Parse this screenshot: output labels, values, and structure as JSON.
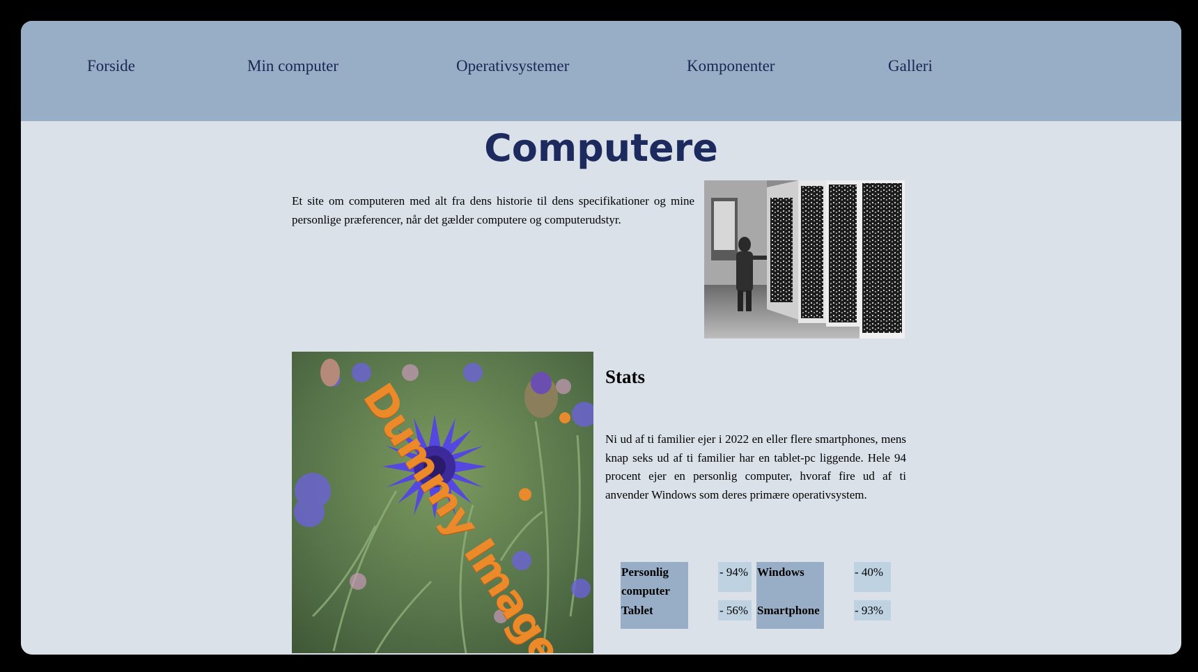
{
  "nav": {
    "items": [
      {
        "label": "Forside"
      },
      {
        "label": "Min computer"
      },
      {
        "label": "Operativsystemer"
      },
      {
        "label": "Komponenter"
      },
      {
        "label": "Galleri"
      }
    ]
  },
  "page": {
    "title": "Computere",
    "intro": "Et site om computeren med alt fra dens historie til dens specifikationer og mine personlige præferencer, når det gælder computere og computerudstyr."
  },
  "images": {
    "flower_overlay": "Dummy Image"
  },
  "stats": {
    "heading": "Stats",
    "text": "Ni ud af ti familier ejer i 2022 en eller flere smartphones, mens knap seks ud af ti familier har en tablet-pc liggende. Hele 94 procent ejer en personlig computer, hvoraf fire ud af ti anvender Windows som deres primære operativsystem.",
    "table": {
      "device_labels": [
        "Personlig computer",
        "Tablet"
      ],
      "device_values": [
        "- 94%",
        "- 56%"
      ],
      "os_labels": [
        "Windows",
        "Smartphone"
      ],
      "os_values": [
        "- 40%",
        "- 93%"
      ]
    }
  },
  "colors": {
    "navbar": "#97aec6",
    "page_background": "#dae1e9",
    "nav_text": "#1a2651",
    "title": "#1c2a5e",
    "label_cell": "#97aec6",
    "value_cell": "#bfd2e2",
    "overlay_text": "#ec8a2a"
  }
}
